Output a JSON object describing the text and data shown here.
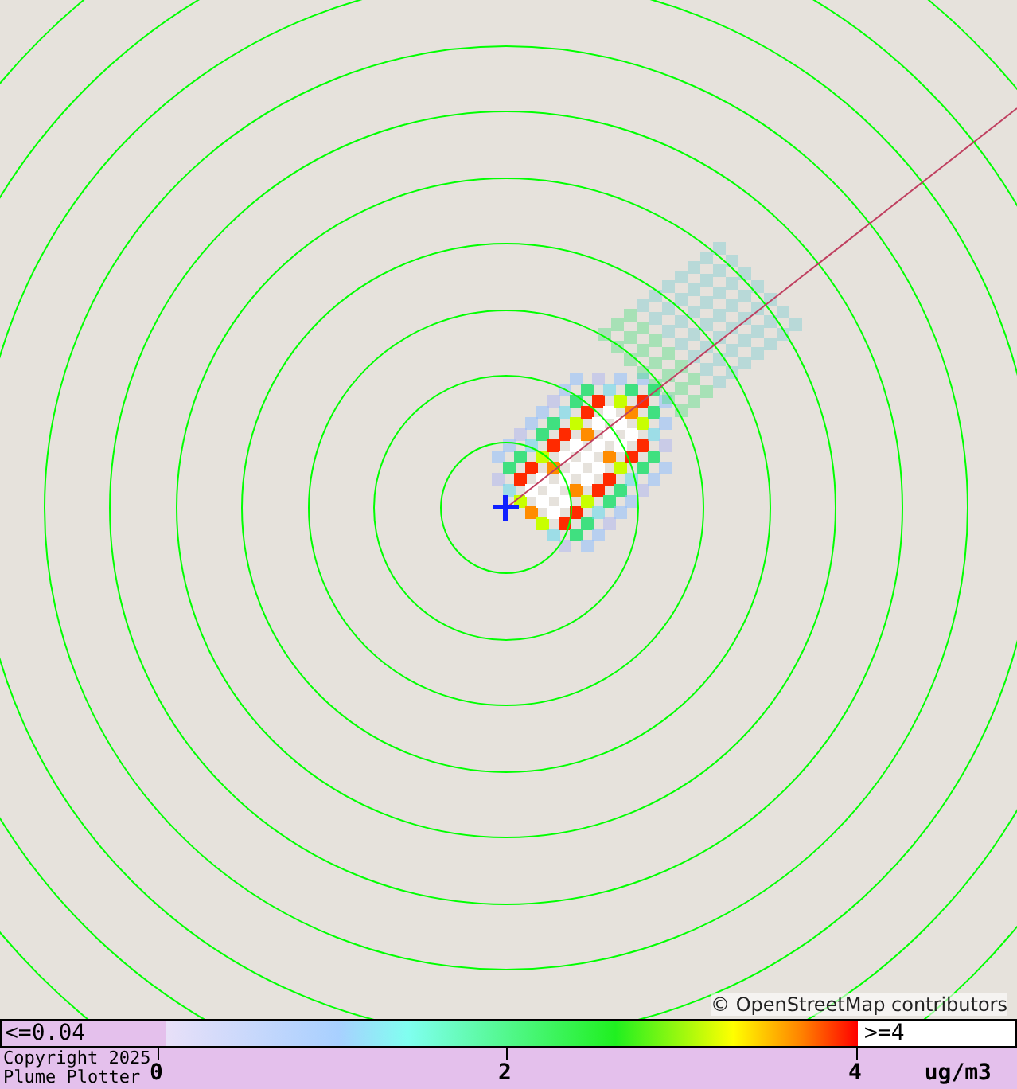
{
  "map": {
    "attribution": "© OpenStreetMap contributors"
  },
  "legend": {
    "low_label": "<=0.04",
    "high_label": ">=4",
    "ticks": [
      "0",
      "2",
      "4"
    ],
    "unit": "ug/m3"
  },
  "footer": {
    "copyright_lines": [
      "Copyright 2025",
      "Plume Plotter"
    ]
  }
}
